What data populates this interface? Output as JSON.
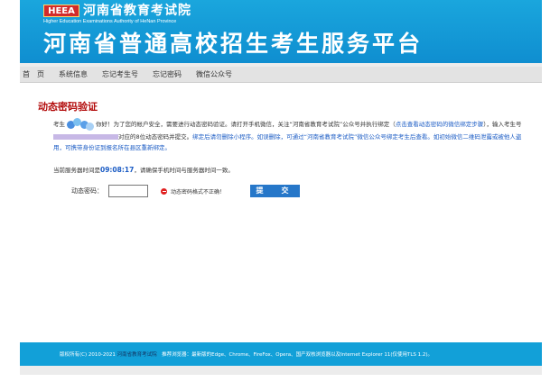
{
  "header": {
    "logo_text": "HEEA",
    "org_name_cn": "河南省教育考试院",
    "org_name_en": "Higher Education Examinations Authority of HeNan Province",
    "site_title": "河南省普通高校招生考生服务平台"
  },
  "nav": {
    "items": [
      "首　页",
      "系统信息",
      "忘记考生号",
      "忘记密码",
      "微信公众号"
    ]
  },
  "main": {
    "title": "动态密码验证",
    "para1": {
      "a": "考生",
      "b": "你好！为了您的帐户安全，需要进行动态密码验证。请打开手机微信，关注“河南省教育考试院”公众号并执行绑定（",
      "link": "点击查看动态密码的微信绑定步骤",
      "c": "），输入考生号",
      "d": "对应的8位动态密码并提交。",
      "e": "绑定后请勿删除小程序。如误删除，可通过“河南省教育考试院”微信公众号绑定考生后查看。如初始微信二维码泄露或被他人盗用，可携带身份证到报名所在县区重新绑定。"
    },
    "time_prefix": "当前服务器时间是",
    "time_value": "09:08:17",
    "time_suffix": "，请确保手机时间与服务器时间一致。",
    "form": {
      "label": "动态密码：",
      "input_value": "",
      "error": "动态密码格式不正确！",
      "submit": "提　交"
    }
  },
  "footer": {
    "prefix": "版权所有(C) 2010-2021 ",
    "link": "河南省教育考试院",
    "suffix": "　推荐浏览器：最新版的Edge、Chrome、FireFox、Opera、国产双核浏览器以及Internet Explorer 11(仅使用TLS 1.2)。"
  },
  "colors": {
    "header_bg": "#12a0d8",
    "title_red": "#b30d0d",
    "link_blue": "#1a5bc4",
    "button_blue": "#2677c9"
  }
}
